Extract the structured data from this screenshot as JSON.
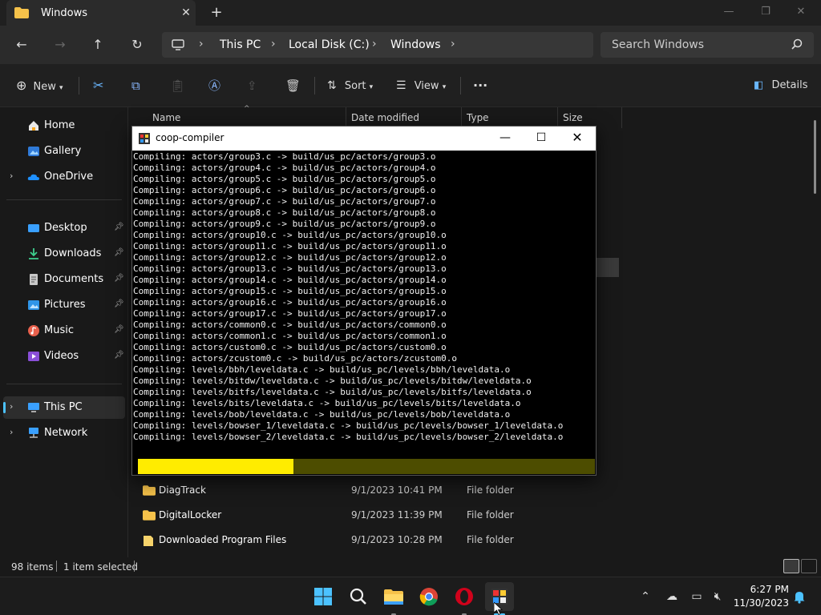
{
  "explorer": {
    "tab_title": "Windows",
    "tab_close": "✕",
    "new_tab": "+",
    "address": {
      "crumbs": [
        "This PC",
        "Local Disk (C:)",
        "Windows"
      ],
      "separator": "›"
    },
    "search": {
      "placeholder": "Search Windows"
    },
    "toolbar": {
      "new_label": "New",
      "sort_label": "Sort",
      "view_label": "View",
      "more_label": "···",
      "details_label": "Details"
    },
    "columns": {
      "name": "Name",
      "date": "Date modified",
      "type": "Type",
      "size": "Size"
    },
    "sidebar": {
      "home": "Home",
      "gallery": "Gallery",
      "onedrive": "OneDrive",
      "desktop": "Desktop",
      "downloads": "Downloads",
      "documents": "Documents",
      "pictures": "Pictures",
      "music": "Music",
      "videos": "Videos",
      "this_pc": "This PC",
      "network": "Network"
    },
    "files": [
      {
        "name": "DiagTrack",
        "date": "9/1/2023 10:41 PM",
        "type": "File folder"
      },
      {
        "name": "DigitalLocker",
        "date": "9/1/2023 11:39 PM",
        "type": "File folder"
      },
      {
        "name": "Downloaded Program Files",
        "date": "9/1/2023 10:28 PM",
        "type": "File folder"
      }
    ],
    "status": {
      "items": "98 items",
      "selected": "1 item selected"
    }
  },
  "console": {
    "title": "coop-compiler",
    "progress": 0.34,
    "lines": [
      "Compiling: actors/group3.c -> build/us_pc/actors/group3.o",
      "Compiling: actors/group4.c -> build/us_pc/actors/group4.o",
      "Compiling: actors/group5.c -> build/us_pc/actors/group5.o",
      "Compiling: actors/group6.c -> build/us_pc/actors/group6.o",
      "Compiling: actors/group7.c -> build/us_pc/actors/group7.o",
      "Compiling: actors/group8.c -> build/us_pc/actors/group8.o",
      "Compiling: actors/group9.c -> build/us_pc/actors/group9.o",
      "Compiling: actors/group10.c -> build/us_pc/actors/group10.o",
      "Compiling: actors/group11.c -> build/us_pc/actors/group11.o",
      "Compiling: actors/group12.c -> build/us_pc/actors/group12.o",
      "Compiling: actors/group13.c -> build/us_pc/actors/group13.o",
      "Compiling: actors/group14.c -> build/us_pc/actors/group14.o",
      "Compiling: actors/group15.c -> build/us_pc/actors/group15.o",
      "Compiling: actors/group16.c -> build/us_pc/actors/group16.o",
      "Compiling: actors/group17.c -> build/us_pc/actors/group17.o",
      "Compiling: actors/common0.c -> build/us_pc/actors/common0.o",
      "Compiling: actors/common1.c -> build/us_pc/actors/common1.o",
      "Compiling: actors/custom0.c -> build/us_pc/actors/custom0.o",
      "Compiling: actors/zcustom0.c -> build/us_pc/actors/zcustom0.o",
      "Compiling: levels/bbh/leveldata.c -> build/us_pc/levels/bbh/leveldata.o",
      "Compiling: levels/bitdw/leveldata.c -> build/us_pc/levels/bitdw/leveldata.o",
      "Compiling: levels/bitfs/leveldata.c -> build/us_pc/levels/bitfs/leveldata.o",
      "Compiling: levels/bits/leveldata.c -> build/us_pc/levels/bits/leveldata.o",
      "Compiling: levels/bob/leveldata.c -> build/us_pc/levels/bob/leveldata.o",
      "Compiling: levels/bowser_1/leveldata.c -> build/us_pc/levels/bowser_1/leveldata.o",
      "Compiling: levels/bowser_2/leveldata.c -> build/us_pc/levels/bowser_2/leveldata.o"
    ]
  },
  "taskbar": {
    "time": "6:27 PM",
    "date": "11/30/2023"
  },
  "colors": {
    "accent": "#4cc2ff",
    "progress_fill": "#ffec00",
    "progress_track": "#4d4d00",
    "folder": "#f6c24a"
  }
}
